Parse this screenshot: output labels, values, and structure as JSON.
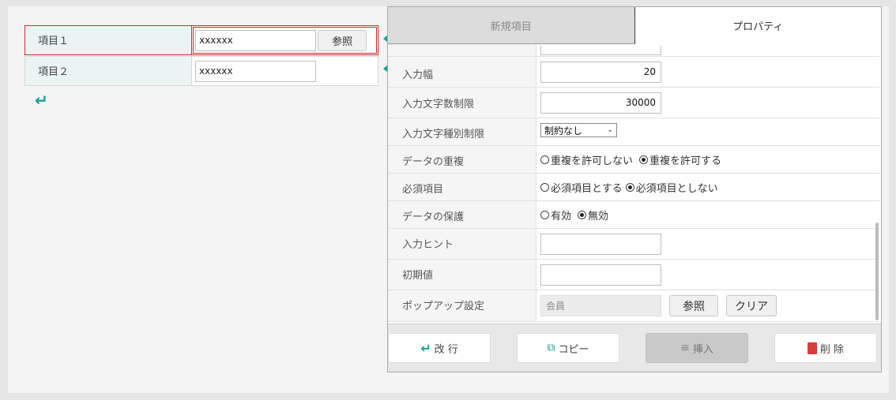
{
  "form": {
    "rows": [
      {
        "label": "項目１",
        "value": "xxxxxx",
        "ref_button": "参照"
      },
      {
        "label": "項目２",
        "value": "xxxxxx"
      }
    ]
  },
  "panel": {
    "tabs": [
      {
        "label": "新規項目"
      },
      {
        "label": "プロパティ"
      }
    ],
    "props": {
      "input_width": {
        "label": "入力幅",
        "value": "20"
      },
      "char_limit": {
        "label": "入力文字数制限",
        "value": "30000"
      },
      "char_type": {
        "label": "入力文字種別制限",
        "value": "制約なし"
      },
      "duplicate": {
        "label": "データの重複",
        "opt1": "重複を許可しない",
        "opt2": "重複を許可する"
      },
      "required": {
        "label": "必須項目",
        "opt1": "必須項目とする",
        "opt2": "必須項目としない"
      },
      "protect": {
        "label": "データの保護",
        "opt1": "有効",
        "opt2": "無効"
      },
      "hint": {
        "label": "入力ヒント"
      },
      "initial": {
        "label": "初期値"
      },
      "popup": {
        "label": "ポップアップ設定",
        "value": "会員",
        "ref_button": "参照",
        "clear_button": "クリア"
      }
    },
    "footer": {
      "newline": "改 行",
      "copy": "コピー",
      "insert": "挿入",
      "delete": "削 除"
    }
  },
  "colors": {
    "accent": "#16a394",
    "selection": "#d02a2a",
    "delete": "#d83b3b"
  }
}
